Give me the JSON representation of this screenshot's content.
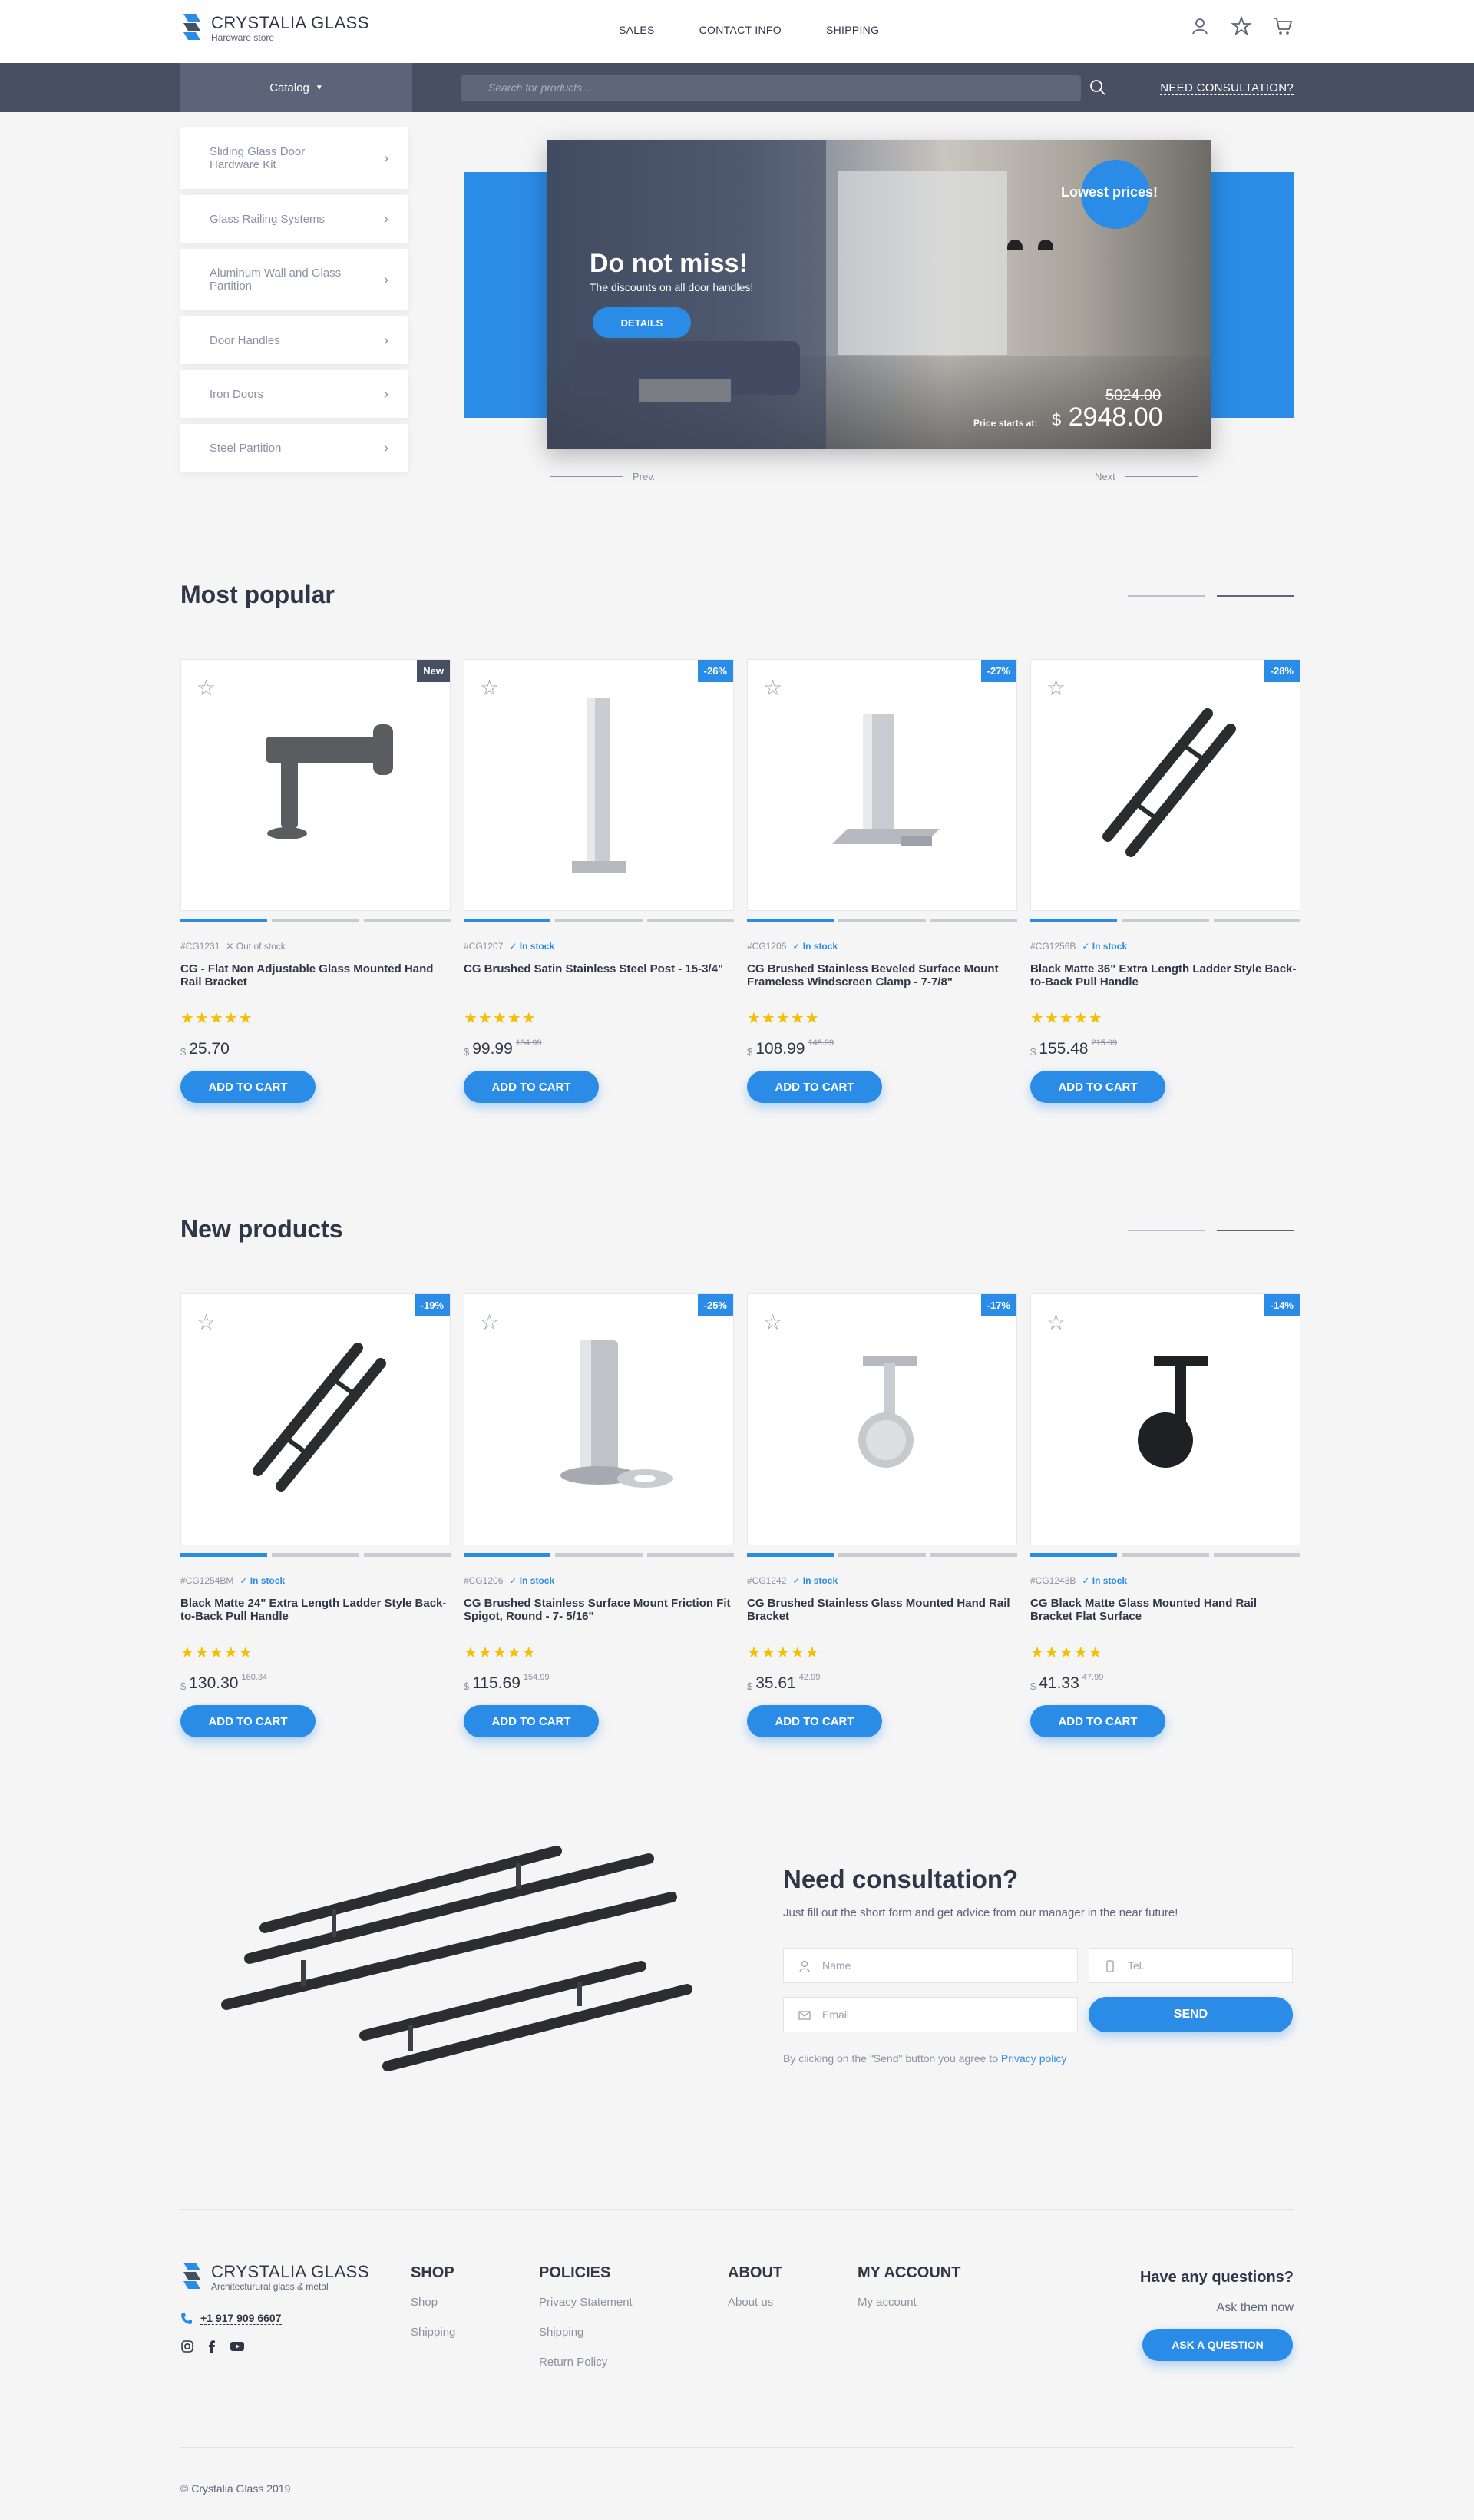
{
  "brand": {
    "name": "CRYSTALIA GLASS",
    "tagline": "Hardware store"
  },
  "nav": [
    "SALES",
    "CONTACT INFO",
    "SHIPPING"
  ],
  "header_icons": [
    "user-icon",
    "star-icon",
    "cart-icon"
  ],
  "catalog_label": "Catalog",
  "search": {
    "placeholder": "Search for products..."
  },
  "consult_link": "NEED CONSULTATION?",
  "sidebar": [
    "Sliding Glass Door Hardware Kit",
    "Glass Railing Systems",
    "Aluminum Wall and Glass Partition",
    "Door Handles",
    "Iron Doors",
    "Steel Partition"
  ],
  "hero": {
    "title": "Do not miss!",
    "subtitle": "The discounts on all door handles!",
    "button": "DETAILS",
    "badge": "Lowest prices!",
    "old_price": "5024.00",
    "price_label": "Price starts at:",
    "currency": "$",
    "price": "2948.00",
    "prev": "Prev.",
    "next": "Next"
  },
  "popular": {
    "title": "Most popular",
    "items": [
      {
        "badge": "New",
        "sku": "#CG1231",
        "stock": "Out of stock",
        "in_stock": false,
        "name": "CG - Flat Non Adjustable Glass Mounted Hand Rail Bracket",
        "price": "25.70",
        "old": "",
        "img": "bracket"
      },
      {
        "badge": "-26%",
        "sku": "#CG1207",
        "stock": "In stock",
        "in_stock": true,
        "name": "CG Brushed Satin Stainless Steel Post - 15-3/4\"",
        "price": "99.99",
        "old": "134.99",
        "img": "post"
      },
      {
        "badge": "-27%",
        "sku": "#CG1205",
        "stock": "In stock",
        "in_stock": true,
        "name": "CG Brushed Stainless Beveled Surface Mount Frameless Windscreen Clamp - 7-7/8\"",
        "price": "108.99",
        "old": "148.99",
        "img": "clamp"
      },
      {
        "badge": "-28%",
        "sku": "#CG1256B",
        "stock": "In stock",
        "in_stock": true,
        "name": "Black Matte 36\" Extra Length Ladder Style Back-to-Back Pull Handle",
        "price": "155.48",
        "old": "215.99",
        "img": "ladder"
      }
    ]
  },
  "newp": {
    "title": "New products",
    "items": [
      {
        "badge": "-19%",
        "sku": "#CG1254BM",
        "stock": "In stock",
        "in_stock": true,
        "name": "Black Matte 24\" Extra Length Ladder Style Back-to-Back Pull Handle",
        "price": "130.30",
        "old": "160.34",
        "img": "ladder"
      },
      {
        "badge": "-25%",
        "sku": "#CG1206",
        "stock": "In stock",
        "in_stock": true,
        "name": "CG Brushed Stainless Surface Mount Friction Fit Spigot, Round - 7- 5/16\"",
        "price": "115.69",
        "old": "154.99",
        "img": "spigot"
      },
      {
        "badge": "-17%",
        "sku": "#CG1242",
        "stock": "In stock",
        "in_stock": true,
        "name": "CG Brushed Stainless Glass Mounted Hand Rail Bracket",
        "price": "35.61",
        "old": "42.99",
        "img": "handrail"
      },
      {
        "badge": "-14%",
        "sku": "#CG1243B",
        "stock": "In stock",
        "in_stock": true,
        "name": "CG Black Matte Glass Mounted Hand Rail Bracket Flat Surface",
        "price": "41.33",
        "old": "47.99",
        "img": "blackrail"
      }
    ]
  },
  "currency": "$",
  "add_to_cart": "ADD TO CART",
  "consult": {
    "title": "Need consultation?",
    "subtitle": "Just fill out the short form and get advice from our manager in the near future!",
    "name_ph": "Name",
    "tel_ph": "Tel.",
    "email_ph": "Email",
    "send": "SEND",
    "agree_text": "By clicking on the \"Send\" button you agree to",
    "agree_link": "Privacy policy"
  },
  "footer": {
    "brand_sub": "Architecturural glass & metal",
    "phone": "+1 917 909 6607",
    "cols": [
      {
        "head": "SHOP",
        "links": [
          "Shop",
          "Shipping"
        ]
      },
      {
        "head": "POLICIES",
        "links": [
          "Privacy Statement",
          "Shipping",
          "Return Policy"
        ]
      },
      {
        "head": "ABOUT",
        "links": [
          "About us"
        ]
      },
      {
        "head": "MY ACCOUNT",
        "links": [
          "My account"
        ]
      }
    ],
    "question": "Have any questions?",
    "ask_now": "Ask them now",
    "ask_btn": "ASK A QUESTION",
    "copyright": "© Crystalia Glass 2019"
  },
  "colors": {
    "accent": "#2b8ce8",
    "dark": "#474f62",
    "star": "#f6be00",
    "bg": "#f5f5f6"
  }
}
